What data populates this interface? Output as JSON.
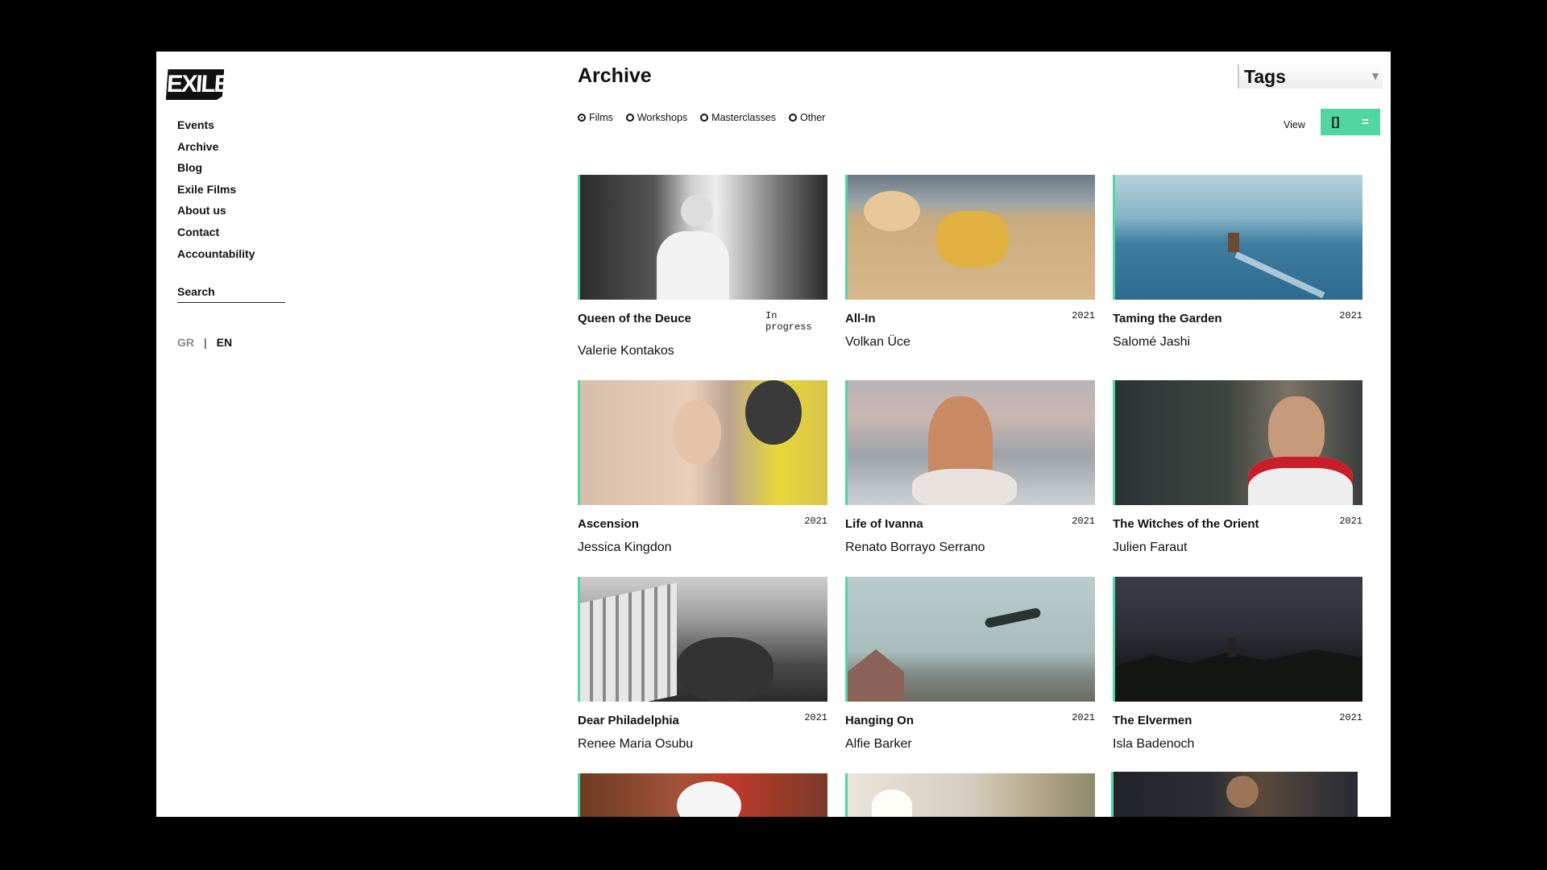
{
  "brand": {
    "logo_text": "EXILE"
  },
  "sidebar": {
    "nav": [
      "Events",
      "Archive",
      "Blog",
      "Exile Films",
      "About us",
      "Contact",
      "Accountability"
    ],
    "search_label": "Search",
    "lang": {
      "gr": "GR",
      "sep": "|",
      "en": "EN"
    }
  },
  "header": {
    "title": "Archive",
    "tags_label": "Tags",
    "filters": [
      "Films",
      "Workshops",
      "Masterclasses",
      "Other"
    ],
    "selected_filter": "Films",
    "view_label": "View",
    "view_grid_icon": "[]",
    "view_list_icon": "="
  },
  "accent_color": "#52d6a1",
  "films": [
    {
      "title": "Queen of the Deuce",
      "year": "In\nprogress",
      "director": "Valerie Kontakos"
    },
    {
      "title": "All-In",
      "year": "2021",
      "director": "Volkan Üce"
    },
    {
      "title": "Taming the Garden",
      "year": "2021",
      "director": "Salomé Jashi"
    },
    {
      "title": "Ascension",
      "year": "2021",
      "director": "Jessica Kingdon"
    },
    {
      "title": "Life of Ivanna",
      "year": "2021",
      "director": "Renato Borrayo Serrano"
    },
    {
      "title": "The Witches of the Orient",
      "year": "2021",
      "director": "Julien Faraut"
    },
    {
      "title": "Dear Philadelphia",
      "year": "2021",
      "director": "Renee Maria Osubu"
    },
    {
      "title": "Hanging On",
      "year": "2021",
      "director": "Alfie Barker"
    },
    {
      "title": "The Elvermen",
      "year": "2021",
      "director": "Isla Badenoch"
    }
  ]
}
